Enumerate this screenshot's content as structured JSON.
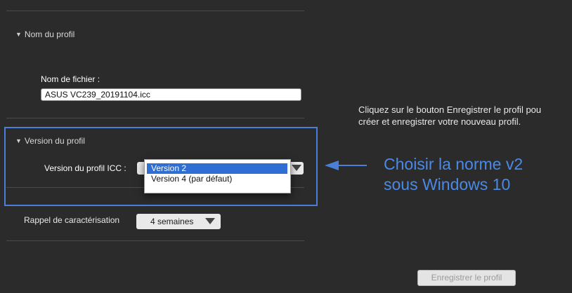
{
  "profile_name_section": {
    "title": "Nom du profil",
    "filename_label": "Nom de fichier :",
    "filename_value": "ASUS VC239_20191104.icc"
  },
  "profile_version_section": {
    "title": "Version du profil",
    "icc_label": "Version du profil ICC :",
    "options": [
      "Version 2",
      "Version 4 (par défaut)"
    ],
    "selected_option": "Version 2"
  },
  "reminder": {
    "label": "Rappel de caractérisation",
    "value": "4 semaines"
  },
  "info": {
    "line1": "Cliquez sur le bouton Enregistrer le profil pou",
    "line2": "créer et enregistrer votre nouveau profil."
  },
  "annotation": {
    "line1": "Choisir la norme v2",
    "line2": "sous Windows 10",
    "color": "#4a8ae6"
  },
  "save_button": {
    "label": "Enregistrer le profil"
  },
  "colors": {
    "background": "#2b2b2b",
    "highlight": "#4a7fd9",
    "selection": "#2f6fd4"
  }
}
